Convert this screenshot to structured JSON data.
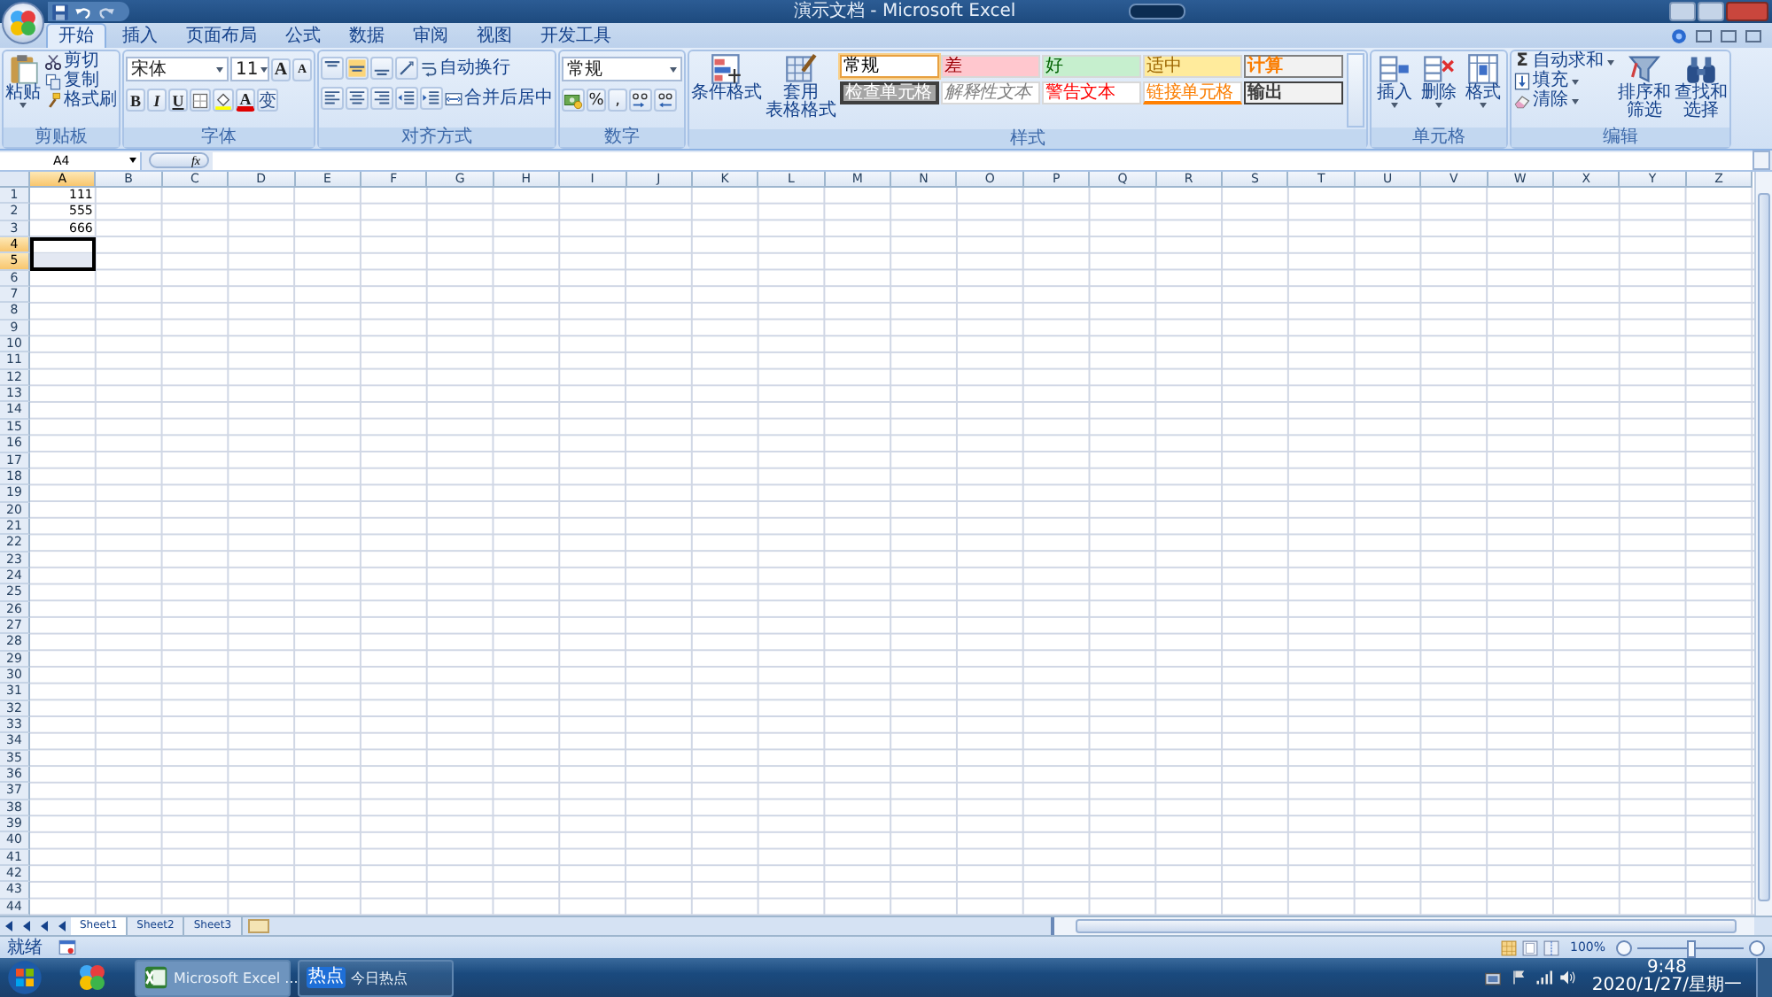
{
  "window": {
    "title": "演示文档 - Microsoft Excel"
  },
  "ribbon_tabs": [
    {
      "label": "开始",
      "selected": true
    },
    {
      "label": "插入",
      "selected": false
    },
    {
      "label": "页面布局",
      "selected": false
    },
    {
      "label": "公式",
      "selected": false
    },
    {
      "label": "数据",
      "selected": false
    },
    {
      "label": "审阅",
      "selected": false
    },
    {
      "label": "视图",
      "selected": false
    },
    {
      "label": "开发工具",
      "selected": false
    }
  ],
  "ribbon_groups": [
    {
      "kind": "clipboard",
      "label": "剪贴板",
      "large": [
        {
          "lines": [
            "粘贴"
          ]
        }
      ],
      "small": [
        {
          "label": "剪切"
        },
        {
          "label": "复制"
        },
        {
          "label": "格式刷"
        }
      ]
    },
    {
      "kind": "font",
      "label": "字体",
      "font": "宋体",
      "size": "11",
      "size_buttons": [
        "A",
        "A"
      ],
      "toggles": [
        "B",
        "I",
        "U"
      ],
      "font_color": "A",
      "phonetic": "变"
    },
    {
      "kind": "alignment",
      "label": "对齐方式",
      "wrap": "自动换行",
      "merge": "合并后居中"
    },
    {
      "kind": "number",
      "label": "数字",
      "format": "常规",
      "percent": "%",
      "comma": ","
    },
    {
      "kind": "styles",
      "label": "样式",
      "large": [
        {
          "lines": [
            "条件格式"
          ]
        },
        {
          "lines": [
            "套用",
            "表格格式"
          ]
        }
      ],
      "swatches": [
        {
          "kind": "plain",
          "label": "常规",
          "selected": true
        },
        {
          "kind": "bad",
          "label": "差",
          "selected": false
        },
        {
          "kind": "good",
          "label": "好",
          "selected": false
        },
        {
          "kind": "neutral",
          "label": "适中",
          "selected": false
        },
        {
          "kind": "calc",
          "label": "计算",
          "selected": false
        },
        {
          "kind": "check",
          "label": "检查单元格",
          "selected": false
        },
        {
          "kind": "explain",
          "label": "解释性文本",
          "selected": false
        },
        {
          "kind": "warn",
          "label": "警告文本",
          "selected": false
        },
        {
          "kind": "linked",
          "label": "链接单元格",
          "selected": false
        },
        {
          "kind": "output",
          "label": "输出",
          "selected": false
        }
      ]
    },
    {
      "kind": "cells",
      "label": "单元格",
      "large": [
        {
          "lines": [
            "插入"
          ]
        },
        {
          "lines": [
            "删除"
          ]
        },
        {
          "lines": [
            "格式"
          ]
        }
      ]
    },
    {
      "kind": "editing",
      "label": "编辑",
      "small": [
        {
          "label": "自动求和",
          "symbol": "Σ"
        },
        {
          "label": "填充"
        },
        {
          "label": "清除"
        }
      ],
      "large": [
        {
          "lines": [
            "排序和",
            "筛选"
          ]
        },
        {
          "lines": [
            "查找和",
            "选择"
          ]
        }
      ]
    }
  ],
  "formula_bar": {
    "name_box": "A4",
    "function_button": "fx"
  },
  "columns": [
    {
      "label": "A",
      "selected": true
    },
    {
      "label": "B",
      "selected": false
    },
    {
      "label": "C",
      "selected": false
    },
    {
      "label": "D",
      "selected": false
    },
    {
      "label": "E",
      "selected": false
    },
    {
      "label": "F",
      "selected": false
    },
    {
      "label": "G",
      "selected": false
    },
    {
      "label": "H",
      "selected": false
    },
    {
      "label": "I",
      "selected": false
    },
    {
      "label": "J",
      "selected": false
    },
    {
      "label": "K",
      "selected": false
    },
    {
      "label": "L",
      "selected": false
    },
    {
      "label": "M",
      "selected": false
    },
    {
      "label": "N",
      "selected": false
    },
    {
      "label": "O",
      "selected": false
    },
    {
      "label": "P",
      "selected": false
    },
    {
      "label": "Q",
      "selected": false
    },
    {
      "label": "R",
      "selected": false
    },
    {
      "label": "S",
      "selected": false
    },
    {
      "label": "T",
      "selected": false
    },
    {
      "label": "U",
      "selected": false
    },
    {
      "label": "V",
      "selected": false
    },
    {
      "label": "W",
      "selected": false
    },
    {
      "label": "X",
      "selected": false
    },
    {
      "label": "Y",
      "selected": false
    },
    {
      "label": "Z",
      "selected": false
    }
  ],
  "rows": [
    {
      "header": "1",
      "selected": false,
      "active": false,
      "cells": [
        "111"
      ]
    },
    {
      "header": "2",
      "selected": false,
      "active": false,
      "cells": [
        "555"
      ]
    },
    {
      "header": "3",
      "selected": false,
      "active": false,
      "cells": [
        "666"
      ]
    },
    {
      "header": "4",
      "selected": true,
      "active": true
    },
    {
      "header": "5",
      "selected": true,
      "active": false
    },
    {
      "header": "6",
      "selected": false,
      "active": false
    },
    {
      "header": "7",
      "selected": false,
      "active": false
    },
    {
      "header": "8",
      "selected": false,
      "active": false
    },
    {
      "header": "9",
      "selected": false,
      "active": false
    },
    {
      "header": "10",
      "selected": false,
      "active": false
    },
    {
      "header": "11",
      "selected": false,
      "active": false
    },
    {
      "header": "12",
      "selected": false,
      "active": false
    },
    {
      "header": "13",
      "selected": false,
      "active": false
    },
    {
      "header": "14",
      "selected": false,
      "active": false
    },
    {
      "header": "15",
      "selected": false,
      "active": false
    },
    {
      "header": "16",
      "selected": false,
      "active": false
    },
    {
      "header": "17",
      "selected": false,
      "active": false
    },
    {
      "header": "18",
      "selected": false,
      "active": false
    },
    {
      "header": "19",
      "selected": false,
      "active": false
    },
    {
      "header": "20",
      "selected": false,
      "active": false
    },
    {
      "header": "21",
      "selected": false,
      "active": false
    },
    {
      "header": "22",
      "selected": false,
      "active": false
    },
    {
      "header": "23",
      "selected": false,
      "active": false
    },
    {
      "header": "24",
      "selected": false,
      "active": false
    },
    {
      "header": "25",
      "selected": false,
      "active": false
    },
    {
      "header": "26",
      "selected": false,
      "active": false
    },
    {
      "header": "27",
      "selected": false,
      "active": false
    },
    {
      "header": "28",
      "selected": false,
      "active": false
    },
    {
      "header": "29",
      "selected": false,
      "active": false
    },
    {
      "header": "30",
      "selected": false,
      "active": false
    },
    {
      "header": "31",
      "selected": false,
      "active": false
    },
    {
      "header": "32",
      "selected": false,
      "active": false
    },
    {
      "header": "33",
      "selected": false,
      "active": false
    },
    {
      "header": "34",
      "selected": false,
      "active": false
    },
    {
      "header": "35",
      "selected": false,
      "active": false
    },
    {
      "header": "36",
      "selected": false,
      "active": false
    },
    {
      "header": "37",
      "selected": false,
      "active": false
    },
    {
      "header": "38",
      "selected": false,
      "active": false
    },
    {
      "header": "39",
      "selected": false,
      "active": false
    },
    {
      "header": "40",
      "selected": false,
      "active": false
    },
    {
      "header": "41",
      "selected": false,
      "active": false
    },
    {
      "header": "42",
      "selected": false,
      "active": false
    },
    {
      "header": "43",
      "selected": false,
      "active": false
    },
    {
      "header": "44",
      "selected": false,
      "active": false
    }
  ],
  "sheets": [
    {
      "label": "Sheet1",
      "selected": true
    },
    {
      "label": "Sheet2",
      "selected": false
    },
    {
      "label": "Sheet3",
      "selected": false
    }
  ],
  "status_bar": {
    "text": "就绪",
    "zoom": "100%",
    "zoom_slider": {
      "level": 0.5
    }
  },
  "taskbar": {
    "buttons": [
      {
        "kind": "excel",
        "label": "Microsoft Excel ...",
        "selected": true
      },
      {
        "kind": "news",
        "label": "今日热点",
        "badge": "热点",
        "selected": false
      }
    ],
    "time": "9:48",
    "date": "2020/1/27/星期一"
  }
}
